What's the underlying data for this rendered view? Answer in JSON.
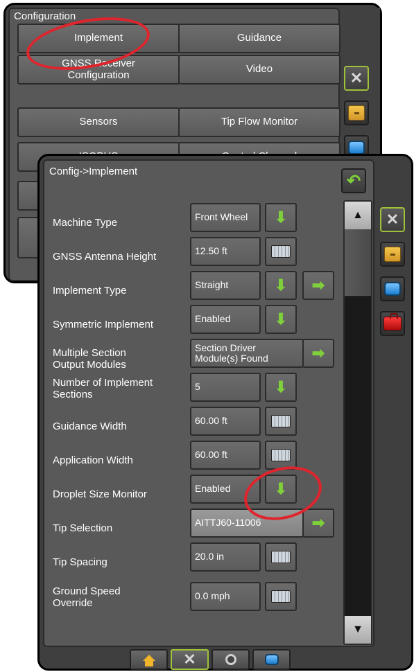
{
  "back_window": {
    "title": "Configuration",
    "buttons": [
      [
        "Implement",
        "Guidance"
      ],
      [
        "GNSS Receiver Configuration",
        "Video"
      ],
      [
        "Sensors",
        "Tip Flow Monitor"
      ],
      [
        "ISOBUS",
        "Control Channel"
      ]
    ],
    "side_tabs": [
      "tools-icon",
      "cabinet-icon",
      "screen-icon"
    ]
  },
  "front_window": {
    "title": "Config->Implement",
    "rows": [
      {
        "label": "Machine Type",
        "value": "Front Wheel",
        "control": "dropdown"
      },
      {
        "label": "GNSS Antenna Height",
        "value": "12.50 ft",
        "control": "keyboard"
      },
      {
        "label": "Implement Type",
        "value": "Straight",
        "control": "dropdown+next"
      },
      {
        "label": "Symmetric Implement",
        "value": "Enabled",
        "control": "dropdown"
      },
      {
        "label": "Multiple Section Output Modules",
        "value": "Section Driver Module(s) Found",
        "control": "next"
      },
      {
        "label": "Number of Implement Sections",
        "value": "5",
        "control": "dropdown"
      },
      {
        "label": "Guidance Width",
        "value": "60.00 ft",
        "control": "keyboard"
      },
      {
        "label": "Application Width",
        "value": "60.00 ft",
        "control": "keyboard"
      },
      {
        "label": "Droplet Size Monitor",
        "value": "Enabled",
        "control": "dropdown"
      },
      {
        "label": "Tip Selection",
        "value": "AITTJ60-11006",
        "control": "next"
      },
      {
        "label": "Tip Spacing",
        "value": "20.0 in",
        "control": "keyboard"
      },
      {
        "label": "Ground Speed Override",
        "value": "0.0 mph",
        "control": "keyboard"
      }
    ],
    "side_tabs": [
      "tools-icon",
      "cabinet-icon",
      "screen-icon",
      "toolbox-icon"
    ],
    "bottom_nav": [
      "home-icon",
      "tools-icon",
      "gauge-icon",
      "data-icon"
    ]
  },
  "colors": {
    "accent_green": "#7fd13b",
    "active_border": "#9fc23b",
    "annotation_red": "#e0242d"
  }
}
